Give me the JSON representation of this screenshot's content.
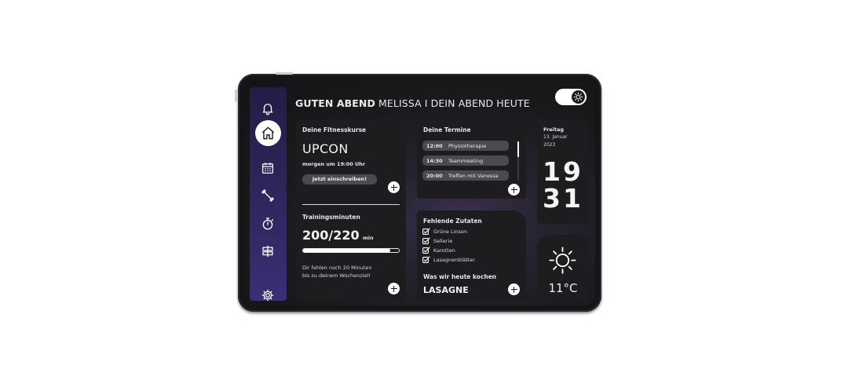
{
  "header": {
    "greeting_bold": "GUTEN ABEND",
    "greeting_rest": "MELISSA I DEIN ABEND HEUTE"
  },
  "sidebar": {
    "items": [
      {
        "icon": "bell-icon"
      },
      {
        "icon": "home-icon",
        "active": true
      },
      {
        "icon": "calendar-icon"
      },
      {
        "icon": "dumbbell-icon"
      },
      {
        "icon": "stopwatch-icon"
      },
      {
        "icon": "signpost-icon"
      },
      {
        "icon": "gear-icon"
      }
    ]
  },
  "theme_toggle": {
    "icon": "sun-icon"
  },
  "fitness": {
    "title": "Deine Fitnesskurse",
    "course": "UPCON",
    "when": "morgen um 19:00 Uhr",
    "cta": "Jetzt einschreiben!",
    "training_title": "Trainingsminuten",
    "value": "200/220",
    "unit": "min",
    "progress": 0.91,
    "hint_line1": "Dir fehlen noch 20 Minuten",
    "hint_line2": "bis zu deinem Wochenziel!"
  },
  "appointments": {
    "title": "Deine Termine",
    "items": [
      {
        "time": "12:00",
        "name": "Physiotherapie"
      },
      {
        "time": "14:30",
        "name": "Teammeeting"
      },
      {
        "time": "20:00",
        "name": "Treffen mit Vanessa"
      }
    ]
  },
  "ingredients": {
    "title": "Fehlende Zutaten",
    "items": [
      "Grüne Linsen",
      "Sellerie",
      "Karotten",
      "Lasagnenblätter"
    ],
    "cook_title": "Was wir heute kochen",
    "dish": "LASAGNE"
  },
  "date": {
    "weekday": "Freitag",
    "day_month": "13. Januar",
    "year": "2023",
    "hours": "19",
    "minutes": "31"
  },
  "weather": {
    "icon": "sun-icon",
    "temp": "11°C"
  },
  "colors": {
    "sidebar_top": "#231d45",
    "sidebar_bottom": "#3a2f73",
    "card": "#1d1d20",
    "accent_white": "#ffffff"
  }
}
